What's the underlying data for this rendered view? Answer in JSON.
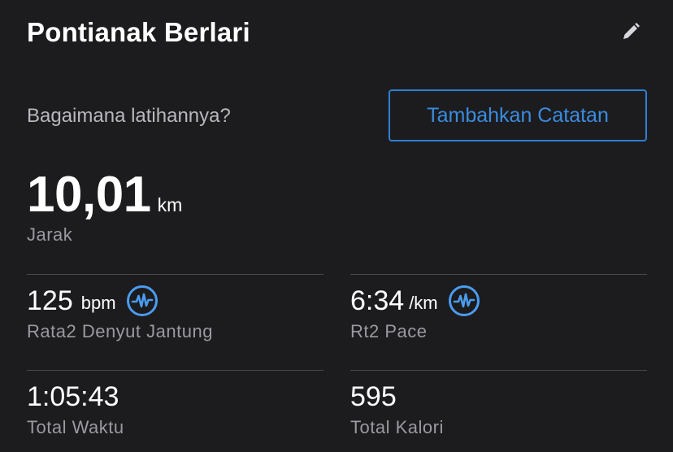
{
  "header": {
    "title": "Pontianak Berlari",
    "edit_icon": "pencil-icon"
  },
  "notes": {
    "prompt": "Bagaimana latihannya?",
    "add_button_label": "Tambahkan Catatan"
  },
  "distance": {
    "value": "10,01",
    "unit": "km",
    "label": "Jarak"
  },
  "stats": {
    "heart_rate": {
      "value": "125",
      "unit": "bpm",
      "label": "Rata2 Denyut Jantung",
      "icon": "heart-rate-icon"
    },
    "pace": {
      "value": "6:34",
      "unit": "/km",
      "label": "Rt2 Pace",
      "icon": "pace-chart-icon"
    },
    "total_time": {
      "value": "1:05:43",
      "label": "Total Waktu"
    },
    "total_calories": {
      "value": "595",
      "label": "Total Kalori"
    }
  },
  "colors": {
    "background": "#1c1c1e",
    "accent": "#2f7fd4",
    "icon_blue": "#4a9cf0",
    "muted_text": "#9a9aa0"
  }
}
